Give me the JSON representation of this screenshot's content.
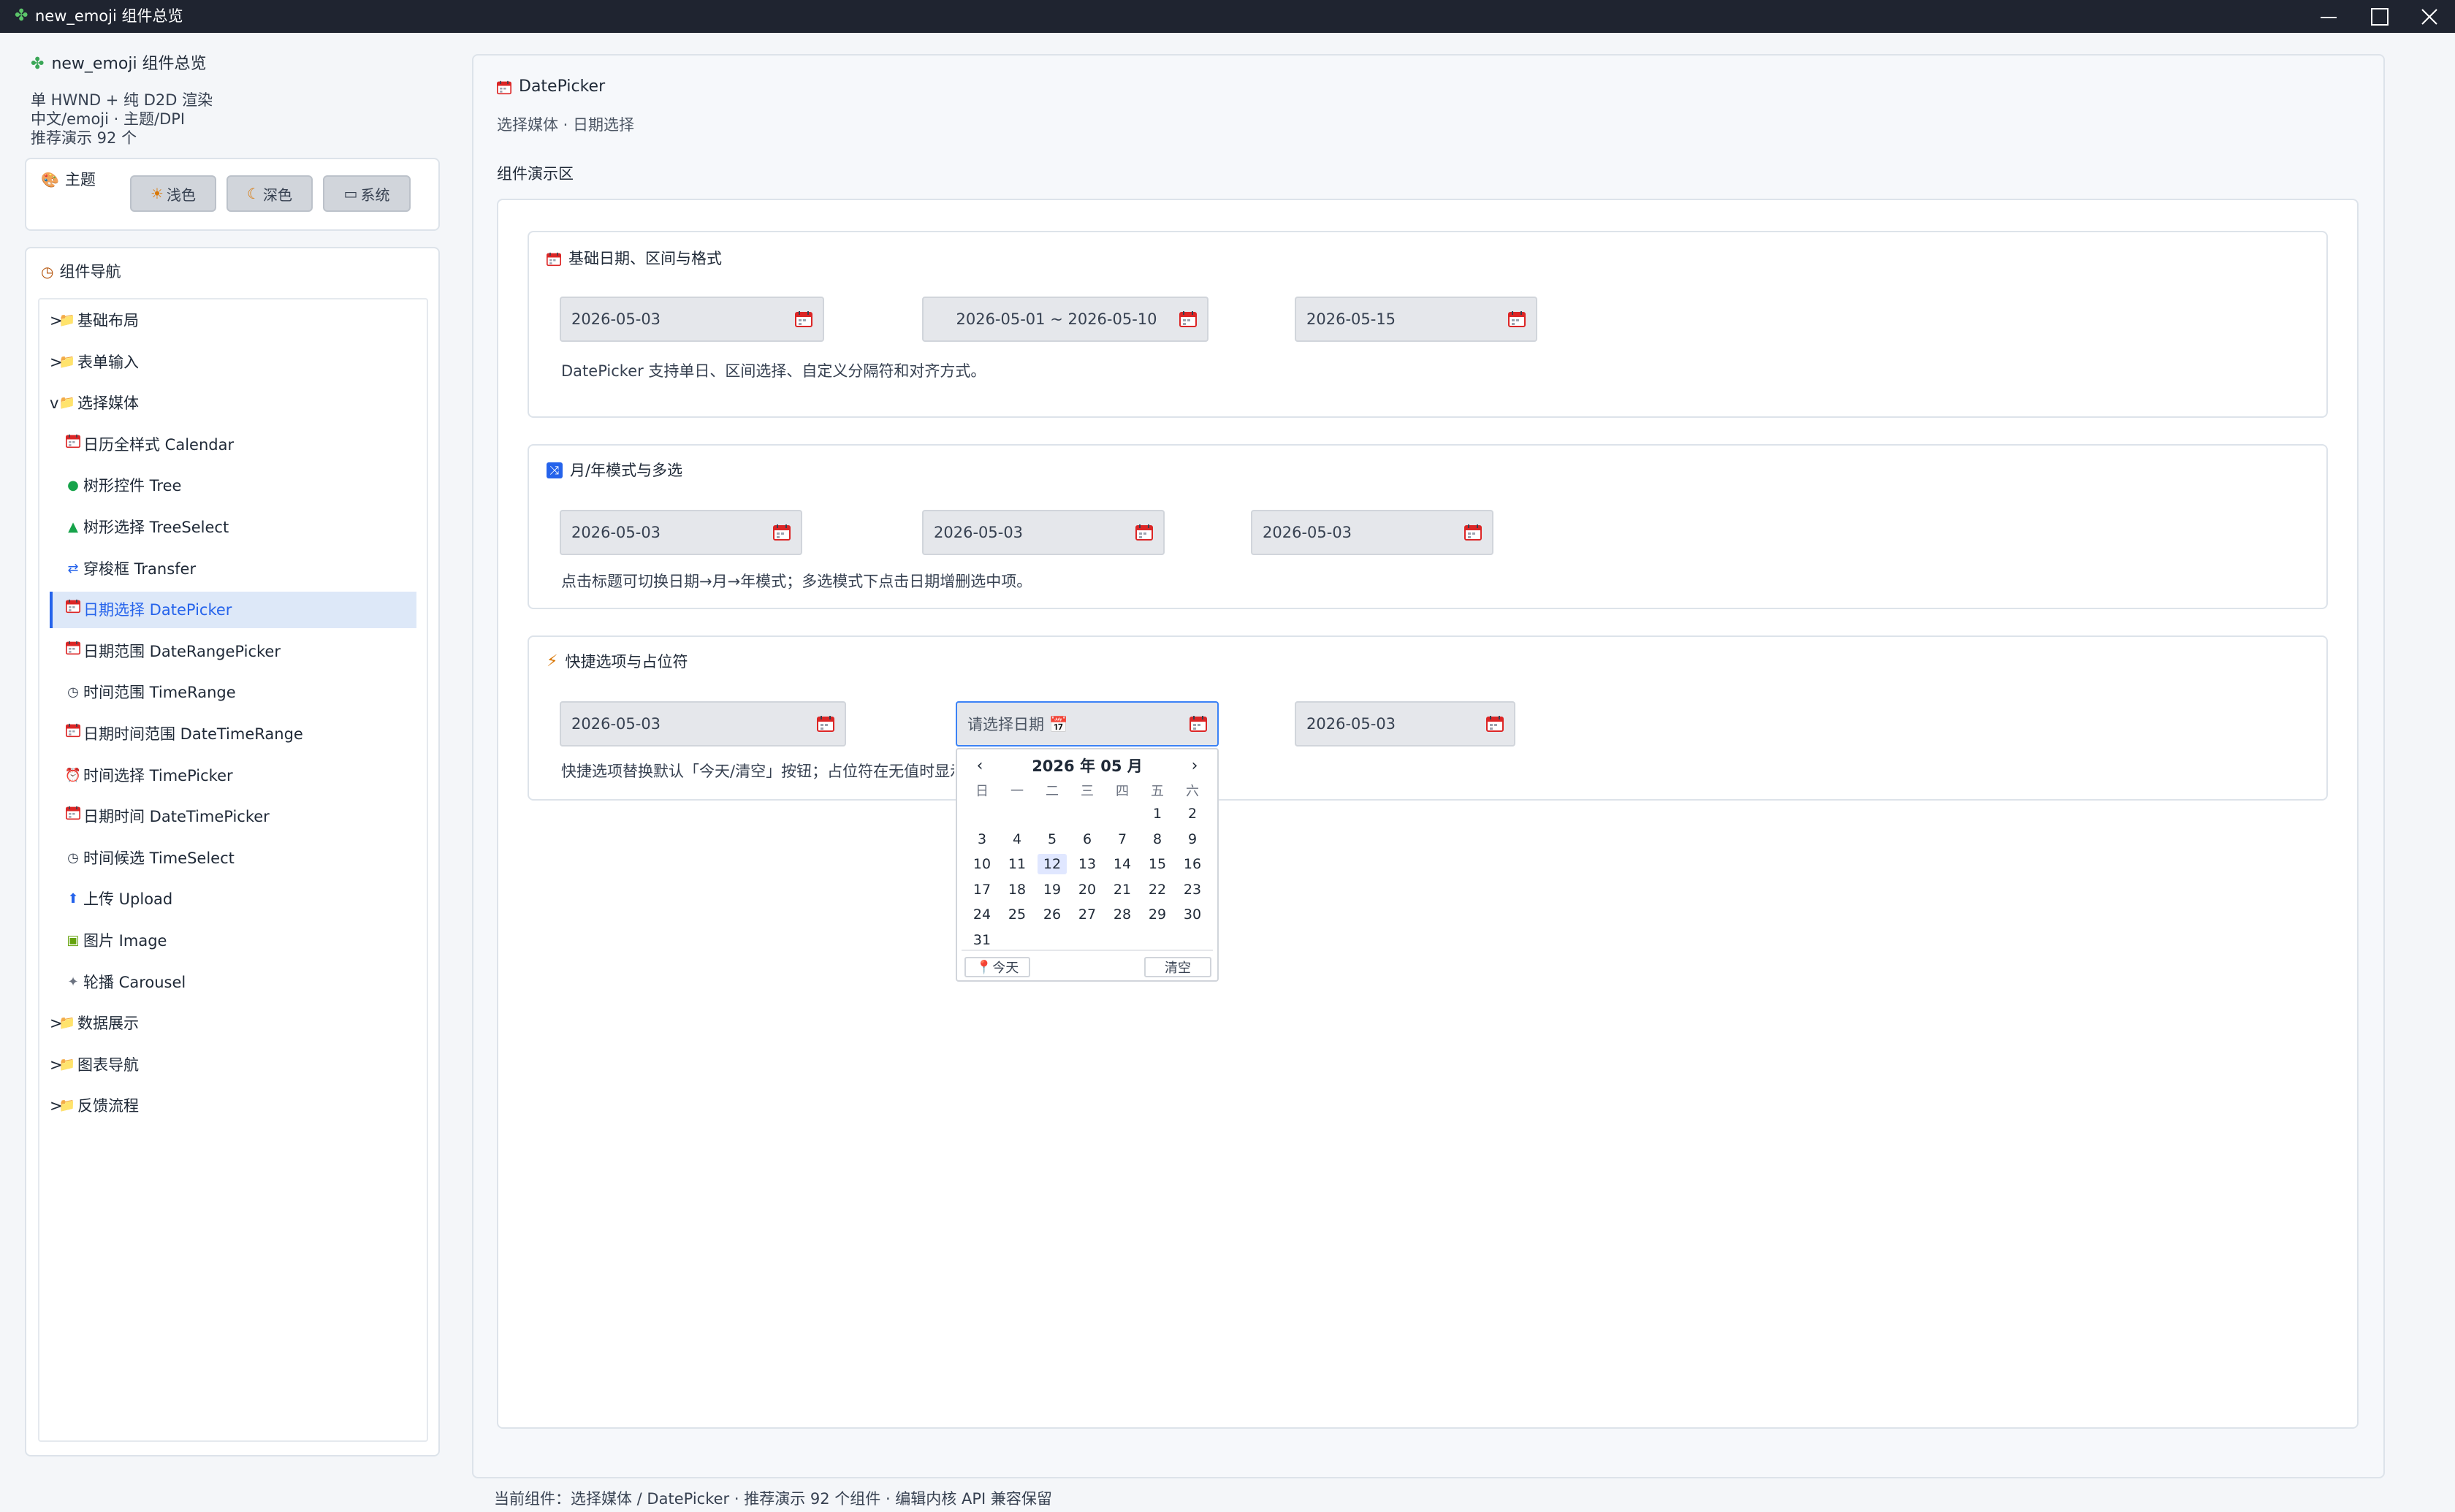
{
  "window": {
    "title": "new_emoji 组件总览",
    "app_icon": "clover-icon",
    "controls": [
      "minimize",
      "maximize",
      "close"
    ]
  },
  "sidebar": {
    "app_title": "new_emoji 组件总览",
    "info_lines": [
      "单 HWND + 纯 D2D 渲染",
      "中文/emoji · 主题/DPI",
      "推荐演示 92 个"
    ],
    "theme": {
      "label": "主题",
      "buttons": [
        {
          "icon": "sun-icon",
          "label": "浅色"
        },
        {
          "icon": "moon-icon",
          "label": "深色"
        },
        {
          "icon": "laptop-icon",
          "label": "系统"
        }
      ]
    },
    "nav": {
      "label": "组件导航",
      "items": [
        {
          "prefix": ">",
          "icon": "folder-icon",
          "label": "基础布局",
          "level": 0
        },
        {
          "prefix": ">",
          "icon": "folder-icon",
          "label": "表单输入",
          "level": 0
        },
        {
          "prefix": "v",
          "icon": "folder-icon",
          "label": "选择媒体",
          "level": 0
        },
        {
          "prefix": "",
          "icon": "calendar-icon",
          "label": "日历全样式 Calendar",
          "level": 1
        },
        {
          "prefix": "",
          "icon": "tree-icon",
          "label": "树形控件 Tree",
          "level": 1
        },
        {
          "prefix": "",
          "icon": "pine-tree-icon",
          "label": "树形选择 TreeSelect",
          "level": 1
        },
        {
          "prefix": "",
          "icon": "transfer-icon",
          "label": "穿梭框 Transfer",
          "level": 1
        },
        {
          "prefix": "",
          "icon": "calendar-icon",
          "label": "日期选择 DatePicker",
          "level": 1,
          "active": true
        },
        {
          "prefix": "",
          "icon": "calendar-icon",
          "label": "日期范围 DateRangePicker",
          "level": 1
        },
        {
          "prefix": "",
          "icon": "clock-icon",
          "label": "时间范围 TimeRange",
          "level": 1
        },
        {
          "prefix": "",
          "icon": "calendar-icon",
          "label": "日期时间范围 DateTimeRange",
          "level": 1
        },
        {
          "prefix": "",
          "icon": "alarm-clock-icon",
          "label": "时间选择 TimePicker",
          "level": 1
        },
        {
          "prefix": "",
          "icon": "calendar-icon",
          "label": "日期时间 DateTimePicker",
          "level": 1
        },
        {
          "prefix": "",
          "icon": "clock-icon",
          "label": "时间候选 TimeSelect",
          "level": 1
        },
        {
          "prefix": "",
          "icon": "upload-icon",
          "label": "上传 Upload",
          "level": 1
        },
        {
          "prefix": "",
          "icon": "image-icon",
          "label": "图片 Image",
          "level": 1
        },
        {
          "prefix": "",
          "icon": "carousel-icon",
          "label": "轮播 Carousel",
          "level": 1
        },
        {
          "prefix": ">",
          "icon": "folder-icon",
          "label": "数据展示",
          "level": 0
        },
        {
          "prefix": ">",
          "icon": "folder-icon",
          "label": "图表导航",
          "level": 0
        },
        {
          "prefix": ">",
          "icon": "folder-icon",
          "label": "反馈流程",
          "level": 0
        }
      ]
    }
  },
  "main": {
    "title": "DatePicker",
    "subtitle": "选择媒体 · 日期选择",
    "area_label": "组件演示区",
    "sections": [
      {
        "title": "基础日期、区间与格式",
        "icon": "calendar-icon",
        "pickers": [
          "2026-05-03",
          "2026-05-01 ~ 2026-05-10",
          "2026-05-15"
        ],
        "description": "DatePicker 支持单日、区间选择、自定义分隔符和对齐方式。"
      },
      {
        "title": "月/年模式与多选",
        "icon": "shuffle-icon",
        "pickers": [
          "2026-05-03",
          "2026-05-03",
          "2026-05-03"
        ],
        "description": "点击标题可切换日期→月→年模式；多选模式下点击日期增删选中项。"
      },
      {
        "title": "快捷选项与占位符",
        "icon": "lightning-icon",
        "pickers": [
          "2026-05-03",
          "请选择日期 📅",
          "2026-05-03"
        ],
        "description": "快捷选项替换默认「今天/清空」按钮；占位符在无值时显示"
      }
    ],
    "calendar_popup": {
      "header": "2026 年 05 月",
      "prev": "‹",
      "next": "›",
      "weekdays": [
        "日",
        "一",
        "二",
        "三",
        "四",
        "五",
        "六"
      ],
      "days": [
        "1",
        "2",
        "3",
        "4",
        "5",
        "6",
        "7",
        "8",
        "9",
        "10",
        "11",
        "12",
        "13",
        "14",
        "15",
        "16",
        "17",
        "18",
        "19",
        "20",
        "21",
        "22",
        "23",
        "24",
        "25",
        "26",
        "27",
        "28",
        "29",
        "30",
        "31"
      ],
      "first_weekday_index": 5,
      "highlighted_day": "12",
      "today_button": "今天",
      "today_icon": "pin-icon",
      "clear_button": "清空"
    }
  },
  "statusbar": {
    "text": "当前组件：选择媒体 / DatePicker · 推荐演示 92 个组件 · 编辑内核 API 兼容保留"
  },
  "colors": {
    "accent": "#2563eb",
    "titlebar": "#1f2430",
    "calendar_icon_red": "#dc2626"
  }
}
